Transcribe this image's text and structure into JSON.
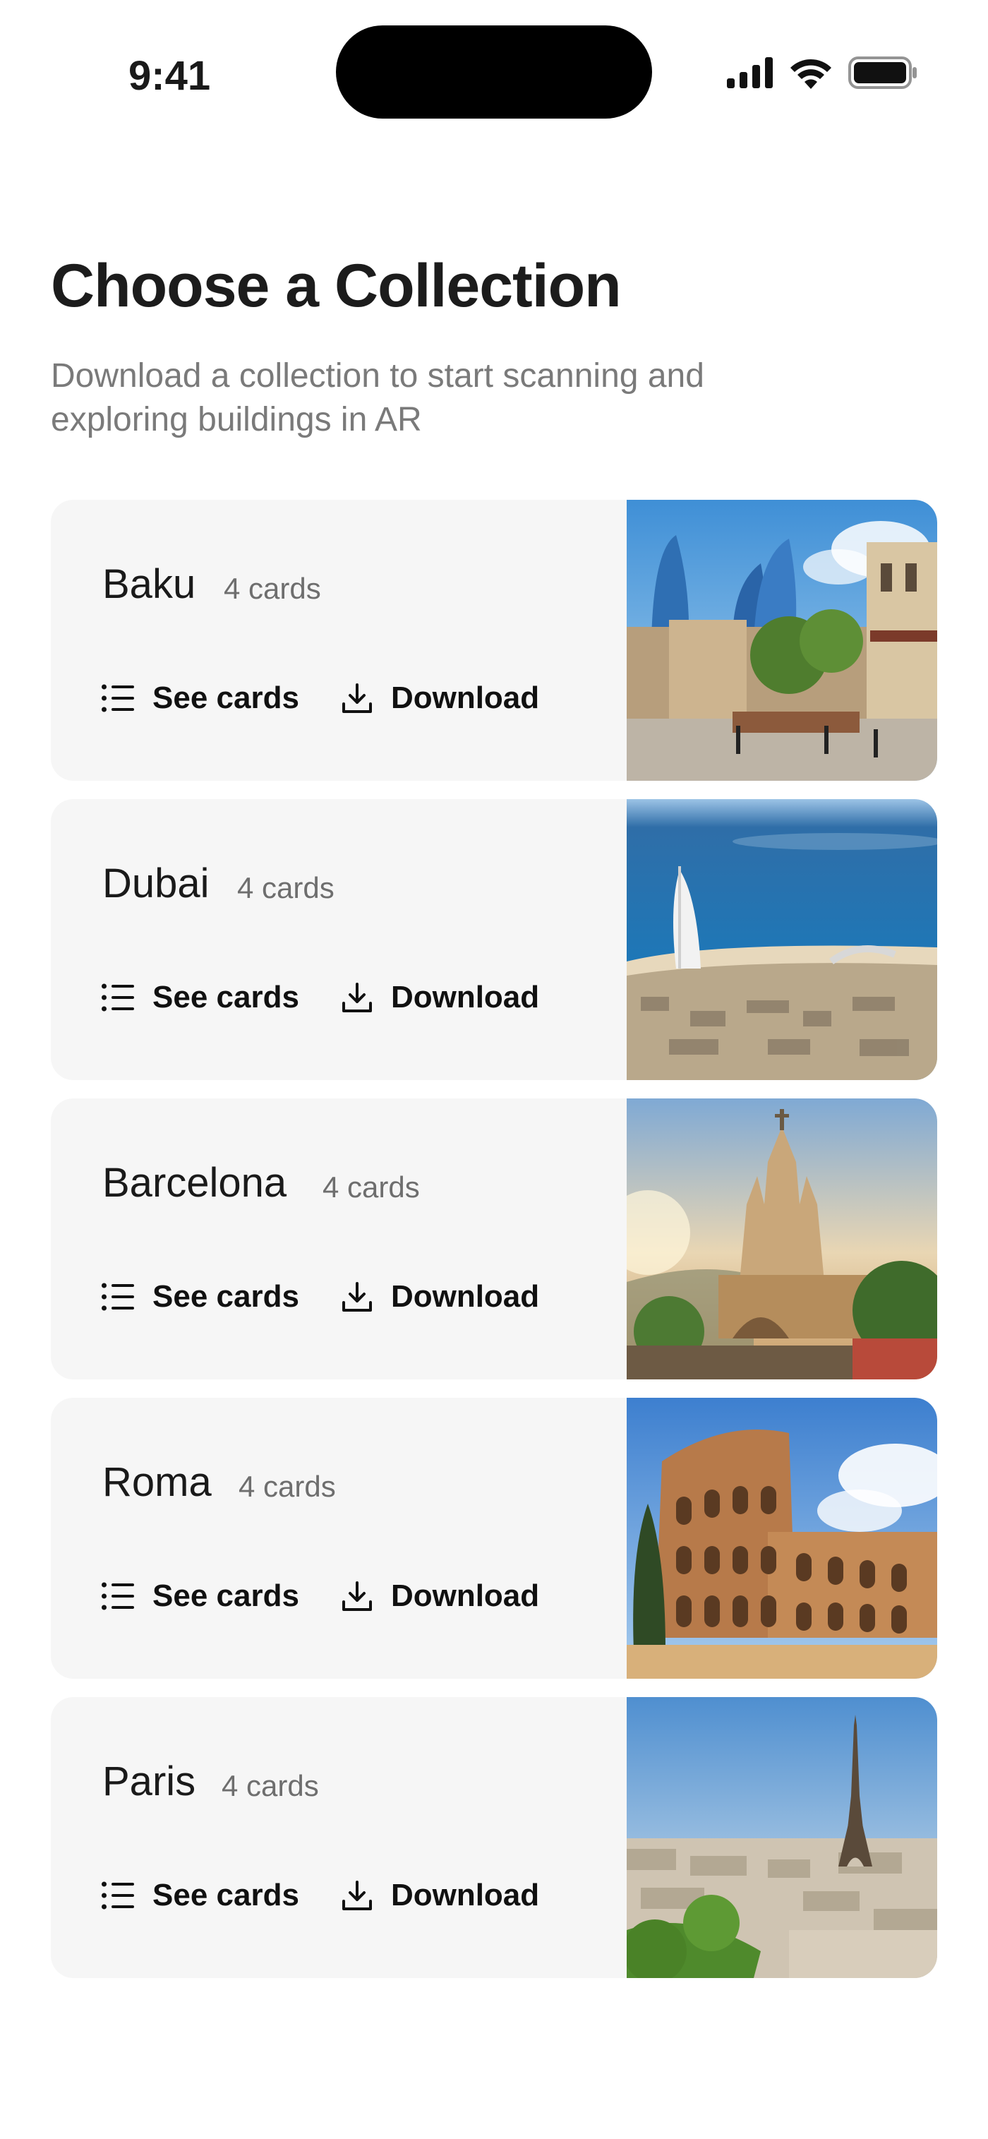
{
  "status_bar": {
    "time": "9:41"
  },
  "header": {
    "title": "Choose a Collection",
    "subtitle": "Download a collection to start scanning and exploring buildings in AR"
  },
  "actions": {
    "see_cards_label": "See cards",
    "download_label": "Download",
    "see_cards_icon": "list-icon",
    "download_icon": "download-icon"
  },
  "collections": [
    {
      "name": "Baku",
      "count": "4 cards"
    },
    {
      "name": "Dubai",
      "count": "4 cards"
    },
    {
      "name": "Barcelona",
      "count": "4 cards"
    },
    {
      "name": "Roma",
      "count": "4 cards"
    },
    {
      "name": "Paris",
      "count": "4 cards"
    }
  ],
  "colors": {
    "card_background": "#f6f6f6",
    "text_primary": "#1a1a1a",
    "text_secondary": "#7a7a7a"
  }
}
